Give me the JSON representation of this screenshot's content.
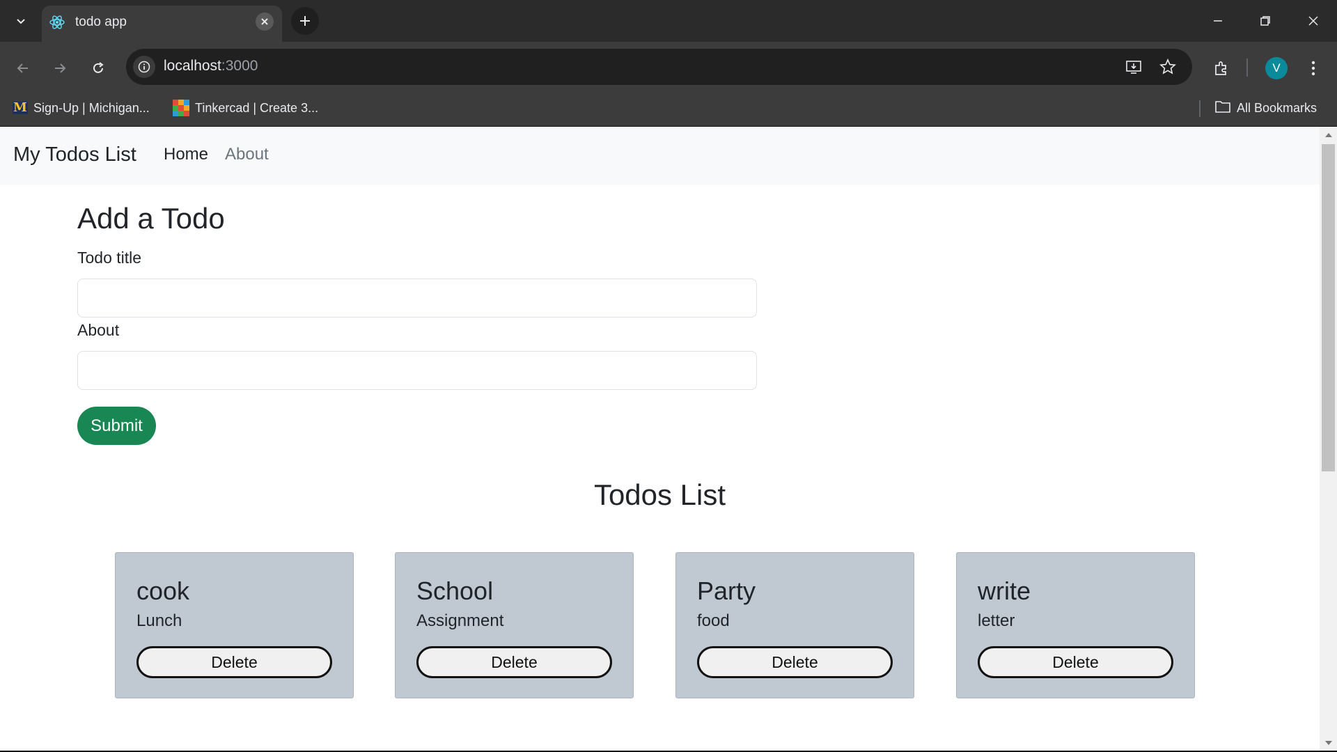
{
  "browser": {
    "tab": {
      "title": "todo app",
      "icon": "react-icon"
    },
    "address": {
      "host": "localhost",
      "port": ":3000"
    },
    "bookmarks": [
      {
        "label": "Sign-Up | Michigan...",
        "icon": "michigan-logo-icon"
      },
      {
        "label": "Tinkercad | Create 3...",
        "icon": "tinkercad-logo-icon"
      }
    ],
    "all_bookmarks_label": "All Bookmarks",
    "profile_initial": "V"
  },
  "navbar": {
    "brand": "My Todos List",
    "links": [
      {
        "label": "Home",
        "active": true
      },
      {
        "label": "About",
        "active": false
      }
    ]
  },
  "form": {
    "heading": "Add a Todo",
    "title_label": "Todo title",
    "title_value": "",
    "about_label": "About",
    "about_value": "",
    "submit_label": "Submit"
  },
  "todos": {
    "heading": "Todos List",
    "items": [
      {
        "title": "cook",
        "desc": "Lunch",
        "delete_label": "Delete"
      },
      {
        "title": "School",
        "desc": "Assignment",
        "delete_label": "Delete"
      },
      {
        "title": "Party",
        "desc": "food",
        "delete_label": "Delete"
      },
      {
        "title": "write",
        "desc": "letter",
        "delete_label": "Delete"
      }
    ]
  },
  "colors": {
    "submit": "#198754",
    "card_bg": "#c0c9d2",
    "navbar_bg": "#f8f9fa",
    "avatar": "#0b8a9c"
  }
}
